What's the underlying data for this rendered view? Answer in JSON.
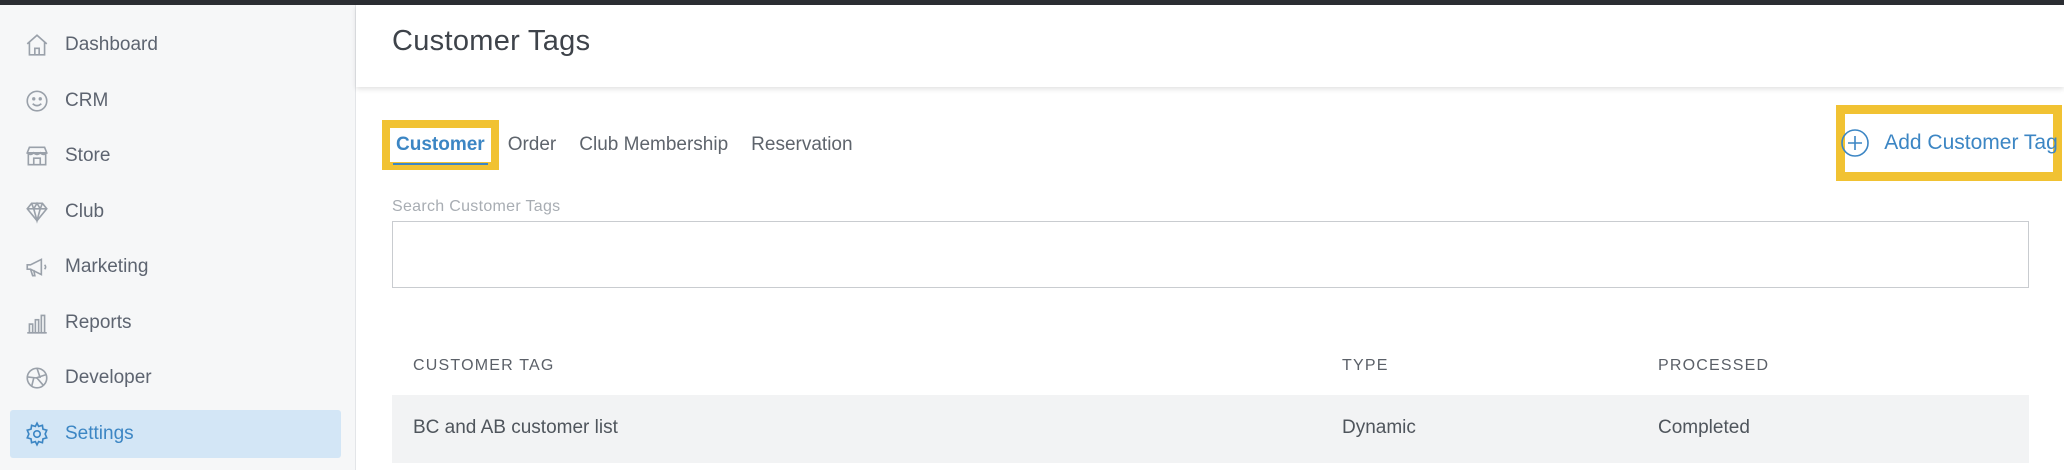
{
  "sidebar": {
    "items": [
      {
        "label": "Dashboard",
        "icon": "home-icon"
      },
      {
        "label": "CRM",
        "icon": "smiley-icon"
      },
      {
        "label": "Store",
        "icon": "store-icon"
      },
      {
        "label": "Club",
        "icon": "diamond-icon"
      },
      {
        "label": "Marketing",
        "icon": "megaphone-icon"
      },
      {
        "label": "Reports",
        "icon": "bar-chart-icon"
      },
      {
        "label": "Developer",
        "icon": "aperture-icon"
      },
      {
        "label": "Settings",
        "icon": "gear-icon",
        "active": true
      }
    ]
  },
  "header": {
    "title": "Customer Tags"
  },
  "tabs": [
    {
      "label": "Customer",
      "active": true
    },
    {
      "label": "Order"
    },
    {
      "label": "Club Membership"
    },
    {
      "label": "Reservation"
    }
  ],
  "actions": {
    "add_label": "Add Customer Tag",
    "add_icon": "plus-circle-icon"
  },
  "search": {
    "label": "Search Customer Tags",
    "value": "",
    "placeholder": ""
  },
  "table": {
    "columns": [
      "CUSTOMER TAG",
      "TYPE",
      "PROCESSED"
    ],
    "rows": [
      {
        "tag": "BC and AB customer list",
        "type": "Dynamic",
        "processed": "Completed"
      }
    ]
  },
  "colors": {
    "accent": "#3c86c4",
    "highlight": "#f1c232",
    "active_bg": "#d3e6f6",
    "topbar": "#2b2e33"
  }
}
